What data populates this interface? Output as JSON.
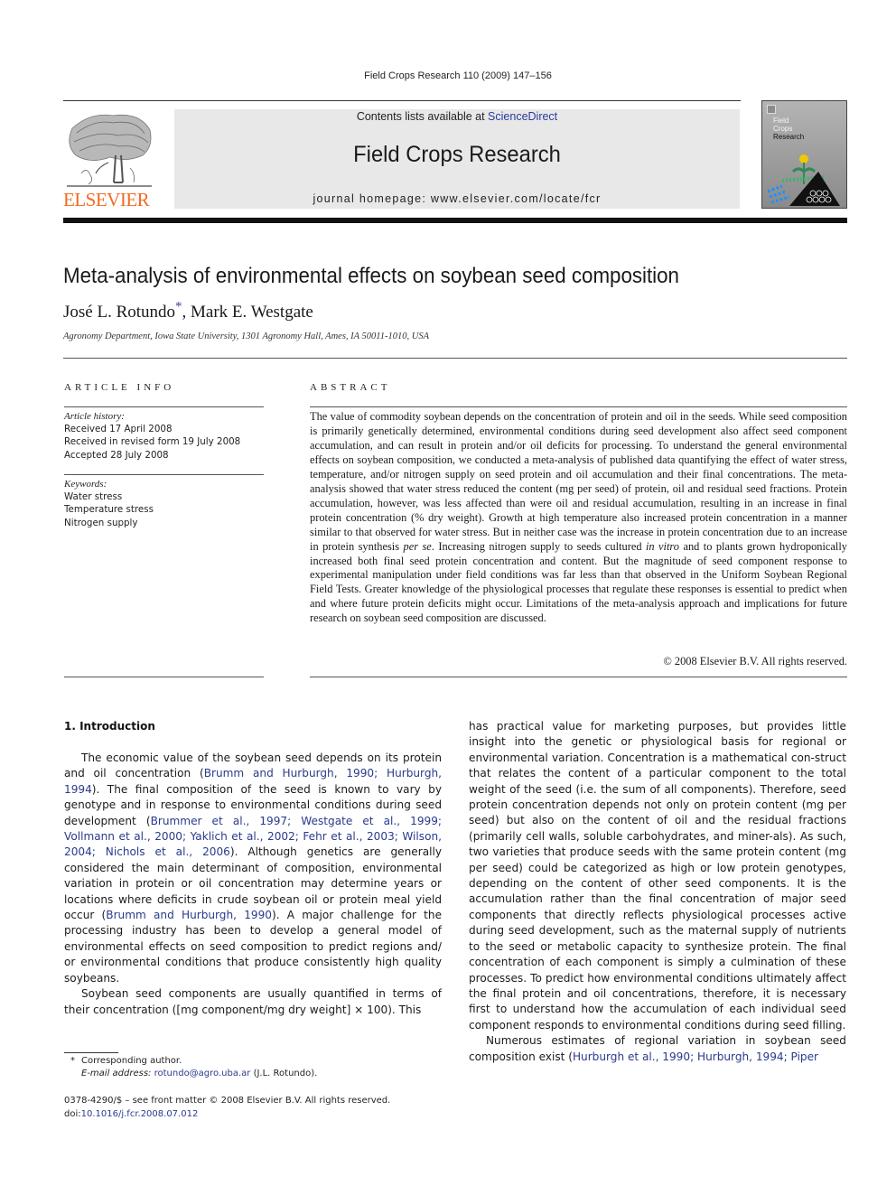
{
  "header": {
    "journal_reference": "Field Crops Research 110 (2009) 147–156",
    "contents_prefix": "Contents lists available at ",
    "contents_link": "ScienceDirect",
    "journal_title": "Field Crops Research",
    "homepage_label": "journal homepage: ",
    "homepage_url": "www.elsevier.com/locate/fcr",
    "publisher_logo_text": "ELSEVIER",
    "cover": {
      "title_lines": [
        "Field",
        "Crops",
        "Research"
      ]
    },
    "colors": {
      "elsevier_orange": "#f26b21",
      "link_blue": "#2a3a8c",
      "masthead_gray": "#e8e8e8"
    }
  },
  "article": {
    "title": "Meta-analysis of environmental effects on soybean seed composition",
    "authors": [
      {
        "name": "José L. Rotundo",
        "mark": "*"
      },
      {
        "name": "Mark E. Westgate",
        "mark": ""
      }
    ],
    "author_separator": ", ",
    "affiliation": "Agronomy Department, Iowa State University, 1301 Agronomy Hall, Ames, IA 50011-1010, USA"
  },
  "article_info": {
    "heading": "ARTICLE INFO",
    "history_label": "Article history:",
    "history": [
      "Received 17 April 2008",
      "Received in revised form 19 July 2008",
      "Accepted 28 July 2008"
    ],
    "keywords_label": "Keywords:",
    "keywords": [
      "Water stress",
      "Temperature stress",
      "Nitrogen supply"
    ]
  },
  "abstract": {
    "heading": "ABSTRACT",
    "segments": [
      {
        "text": "The value of commodity soybean depends on the concentration of protein and oil in the seeds. While seed composition is primarily genetically determined, environmental conditions during seed development also affect seed component accumulation, and can result in protein and/or oil deficits for processing. To understand the general environmental effects on soybean composition, we conducted a meta-analysis of published data quantifying the effect of water stress, temperature, and/or nitrogen supply on seed protein and oil accumulation and their final concentrations. The meta-analysis showed that water stress reduced the content (mg per seed) of protein, oil and residual seed fractions. Protein accumulation, however, was less affected than were oil and residual accumulation, resulting in an increase in final protein concentration (% dry weight). Growth at high temperature also increased protein concentration in a manner similar to that observed for water stress. But in neither case was the increase in protein concentration due to an increase in protein synthesis "
      },
      {
        "text": "per se",
        "italic": true
      },
      {
        "text": ". Increasing nitrogen supply to seeds cultured "
      },
      {
        "text": "in vitro",
        "italic": true
      },
      {
        "text": " and to plants grown hydroponically increased both final seed protein concentration and content. But the magnitude of seed component response to experimental manipulation under field conditions was far less than that observed in the Uniform Soybean Regional Field Tests. Greater knowledge of the physiological processes that regulate these responses is essential to predict when and where future protein deficits might occur. Limitations of the meta-analysis approach and implications for future research on soybean seed composition are discussed."
      }
    ],
    "copyright": "© 2008 Elsevier B.V. All rights reserved."
  },
  "introduction": {
    "heading": "1. Introduction",
    "left_column": [
      [
        {
          "text": "The economic value of the soybean seed depends on its protein and oil concentration ("
        },
        {
          "text": "Brumm and Hurburgh, 1990; Hurburgh, 1994",
          "link": true
        },
        {
          "text": "). The final composition of the seed is known to vary by genotype and in response to environmental conditions during seed development ("
        },
        {
          "text": "Brummer et al., 1997; Westgate et al., 1999; Vollmann et al., 2000; Yaklich et al., 2002; Fehr et al., 2003; Wilson, 2004; Nichols et al., 2006",
          "link": true
        },
        {
          "text": "). Although genetics are generally considered the main determinant of composition, environmental variation in protein or oil concentration may determine years or locations where deficits in crude soybean oil or protein meal yield occur ("
        },
        {
          "text": "Brumm and Hurburgh, 1990",
          "link": true
        },
        {
          "text": "). A major challenge for the processing industry has been to develop a general model of environmental effects on seed composition to predict regions and/ or environmental conditions that produce consistently high quality soybeans."
        }
      ],
      [
        {
          "text": "Soybean seed components are usually quantified in terms of their concentration ([mg component/mg dry weight] × 100). This"
        }
      ]
    ],
    "right_column": [
      [
        {
          "text": "has practical value for marketing purposes, but provides little insight into the genetic or physiological basis for regional or environmental variation. Concentration is a mathematical con-struct that relates the content of a particular component to the total weight of the seed (i.e. the sum of all components). Therefore, seed protein concentration depends not only on protein content (mg per seed) but also on the content of oil and the residual fractions (primarily cell walls, soluble carbohydrates, and miner-als). As such, two varieties that produce seeds with the same protein content (mg per seed) could be categorized as high or low protein genotypes, depending on the content of other seed components. It is the accumulation rather than the final concentration of major seed components that directly reflects physiological processes active during seed development, such as the maternal supply of nutrients to the seed or metabolic capacity to synthesize protein. The final concentration of each component is simply a culmination of these processes. To predict how environmental conditions ultimately affect the final protein and oil concentrations, therefore, it is necessary first to understand how the accumulation of each individual seed component responds to environmental conditions during seed filling."
        }
      ],
      [
        {
          "text": "Numerous estimates of regional variation in soybean seed composition exist ("
        },
        {
          "text": "Hurburgh et al., 1990; Hurburgh, 1994; Piper",
          "link": true
        }
      ]
    ]
  },
  "footnote": {
    "mark": "*",
    "corresponding_label": "Corresponding author.",
    "email_label": "E-mail address:",
    "email": "rotundo@agro.uba.ar",
    "email_owner": " (J.L. Rotundo)."
  },
  "front_matter": {
    "issn_line": "0378-4290/$ – see front matter © 2008 Elsevier B.V. All rights reserved.",
    "doi_label": "doi:",
    "doi": "10.1016/j.fcr.2008.07.012"
  }
}
